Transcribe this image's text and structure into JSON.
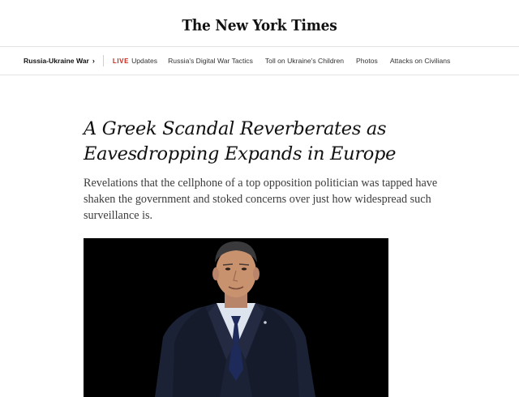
{
  "masthead": {
    "logo_text": "The New York Times"
  },
  "nav": {
    "section_label": "Russia-Ukraine War",
    "section_chevron": "›",
    "live_tag": "LIVE",
    "live_label": "Updates",
    "links": [
      "Russia's Digital War Tactics",
      "Toll on Ukraine's Children",
      "Photos",
      "Attacks on Civilians"
    ]
  },
  "article": {
    "headline": "A Greek Scandal Reverberates as Eavesdropping Expands in Europe",
    "summary": "Revelations that the cellphone of a top opposition politician was tapped have shaken the government and stoked concerns over just how widespread such surveillance is."
  },
  "colors": {
    "live_accent": "#c8271b",
    "photo_background": "#000000",
    "suit": "#1c2236",
    "tie": "#1d2a5a"
  }
}
